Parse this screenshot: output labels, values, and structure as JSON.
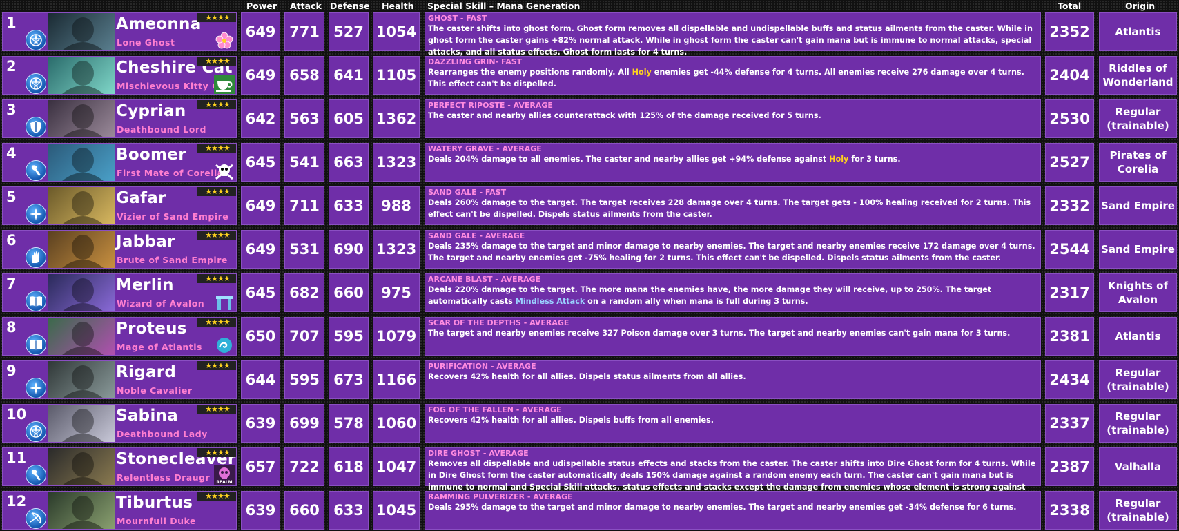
{
  "headers": {
    "power": "Power",
    "attack": "Attack",
    "defense": "Defense",
    "health": "Health",
    "skill": "Special Skill – Mana Generation",
    "total": "Total",
    "origin": "Origin"
  },
  "heroes": [
    {
      "rank": "1",
      "name": "Ameonna",
      "title": "Lone Ghost",
      "stars": "★★★★",
      "class_icon": "paladin-pentagram-icon",
      "family_icon": "sakura-flower-icon",
      "power": "649",
      "attack": "771",
      "defense": "527",
      "health": "1054",
      "skill_name": "GHOST - FAST",
      "desc_a": "The caster shifts into ghost form. Ghost form removes all dispellable and undispellable buffs and status ailments from the caster. While in ghost form the caster gains +82% normal attack. While in ghost form the caster can't gain mana but is immune to normal attacks, special attacks, and all status effects. Ghost form lasts for 4 turns.",
      "hl_b": "",
      "desc_c": "",
      "hl_type": "",
      "total": "2352",
      "origin": "Atlantis"
    },
    {
      "rank": "2",
      "name": "Cheshire Cat",
      "title": "Mischievous Kitty Cat",
      "stars": "★★★★",
      "class_icon": "paladin-pentagram-icon",
      "family_icon": "teacup-icon",
      "power": "649",
      "attack": "658",
      "defense": "641",
      "health": "1105",
      "skill_name": "DAZZLING GRIN- FAST",
      "desc_a": "Rearranges the enemy positions randomly. All ",
      "hl_b": "Holy",
      "desc_c": " enemies get -44% defense for 4 turns. All enemies receive 276 damage over 4 turns. This effect can't be dispelled.",
      "hl_type": "yellow",
      "total": "2404",
      "origin": "Riddles of Wonderland"
    },
    {
      "rank": "3",
      "name": "Cyprian",
      "title": "Deathbound Lord",
      "stars": "★★★★",
      "class_icon": "fighter-shield-icon",
      "family_icon": "",
      "power": "642",
      "attack": "563",
      "defense": "605",
      "health": "1362",
      "skill_name": "PERFECT RIPOSTE - AVERAGE",
      "desc_a": "The caster and nearby allies counterattack with 125% of the damage received for 5 turns.",
      "hl_b": "",
      "desc_c": "",
      "hl_type": "",
      "total": "2530",
      "origin": "Regular (trainable)"
    },
    {
      "rank": "4",
      "name": "Boomer",
      "title": "First Mate of Corelia",
      "stars": "★★★★",
      "class_icon": "barbarian-axe-icon",
      "family_icon": "skull-crossbones-icon",
      "power": "645",
      "attack": "541",
      "defense": "663",
      "health": "1323",
      "skill_name": "WATERY GRAVE - AVERAGE",
      "desc_a": "Deals 204% damage to all enemies. The caster and nearby allies get +94% defense against ",
      "hl_b": "Holy",
      "desc_c": " for 3 turns.",
      "hl_type": "yellow",
      "total": "2527",
      "origin": "Pirates of Corelia"
    },
    {
      "rank": "5",
      "name": "Gafar",
      "title": "Vizier of Sand Empire",
      "stars": "★★★★",
      "class_icon": "cleric-star-icon",
      "family_icon": "",
      "power": "649",
      "attack": "711",
      "defense": "633",
      "health": "988",
      "skill_name": "SAND GALE - FAST",
      "desc_a": "Deals 260% damage to the target. The target receives 228 damage over 4 turns. The target gets - 100% healing received for 2 turns. This effect can't be dispelled. Dispels status ailments from the caster.",
      "hl_b": "",
      "desc_c": "",
      "hl_type": "",
      "total": "2332",
      "origin": "Sand Empire"
    },
    {
      "rank": "6",
      "name": "Jabbar",
      "title": "Brute of Sand Empire",
      "stars": "★★★★",
      "class_icon": "monk-hand-icon",
      "family_icon": "",
      "power": "649",
      "attack": "531",
      "defense": "690",
      "health": "1323",
      "skill_name": "SAND GALE - AVERAGE",
      "desc_a": "Deals 235% damage to the target and minor damage to nearby enemies. The target and nearby enemies receive 172 damage over 4 turns. The target and nearby enemies get -75% healing for 2 turns. This effect can't be dispelled. Dispels status ailments from the caster.",
      "hl_b": "",
      "desc_c": "",
      "hl_type": "",
      "total": "2544",
      "origin": "Sand Empire"
    },
    {
      "rank": "7",
      "name": "Merlin",
      "title": "Wizard of Avalon",
      "stars": "★★★★",
      "class_icon": "wizard-book-icon",
      "family_icon": "stonehenge-icon",
      "power": "645",
      "attack": "682",
      "defense": "660",
      "health": "975",
      "skill_name": "ARCANE BLAST - AVERAGE",
      "desc_a": "Deals 220% damage to the target. The more mana the enemies have, the more damage they will receive, up to 250%. The target automatically casts ",
      "hl_b": "Mindless Attack",
      "desc_c": " on a random ally when mana is full during 3 turns.",
      "hl_type": "blue",
      "total": "2317",
      "origin": "Knights of Avalon"
    },
    {
      "rank": "8",
      "name": "Proteus",
      "title": "Mage of Atlantis",
      "stars": "★★★★",
      "class_icon": "wizard-book-icon",
      "family_icon": "atlantis-wave-icon",
      "power": "650",
      "attack": "707",
      "defense": "595",
      "health": "1079",
      "skill_name": "SCAR OF THE DEPTHS - AVERAGE",
      "desc_a": "The target and nearby enemies receive 327 Poison damage over 3 turns. The target and nearby enemies can't gain mana for 3 turns.",
      "hl_b": "",
      "desc_c": "",
      "hl_type": "",
      "total": "2381",
      "origin": "Atlantis"
    },
    {
      "rank": "9",
      "name": "Rigard",
      "title": "Noble Cavalier",
      "stars": "★★★★",
      "class_icon": "cleric-star-icon",
      "family_icon": "",
      "power": "644",
      "attack": "595",
      "defense": "673",
      "health": "1166",
      "skill_name": "PURIFICATION - AVERAGE",
      "desc_a": "Recovers 42% health for all allies. Dispels status ailments from all allies.",
      "hl_b": "",
      "desc_c": "",
      "hl_type": "",
      "total": "2434",
      "origin": "Regular (trainable)"
    },
    {
      "rank": "10",
      "name": "Sabina",
      "title": "Deathbound Lady",
      "stars": "★★★★",
      "class_icon": "paladin-pentagram-icon",
      "family_icon": "",
      "power": "639",
      "attack": "699",
      "defense": "578",
      "health": "1060",
      "skill_name": "FOG OF THE FALLEN - AVERAGE",
      "desc_a": "Recovers 42% health for all allies. Dispels buffs from all enemies.",
      "hl_b": "",
      "desc_c": "",
      "hl_type": "",
      "total": "2337",
      "origin": "Regular (trainable)"
    },
    {
      "rank": "11",
      "name": "Stonecleaver",
      "title": "Relentless Draugr",
      "stars": "★★★★",
      "class_icon": "barbarian-axe-icon",
      "family_icon": "realm-skull-icon",
      "family_label": "REALM",
      "power": "657",
      "attack": "722",
      "defense": "618",
      "health": "1047",
      "skill_name": "DIRE GHOST - AVERAGE",
      "desc_a": "Removes all dispellable and udispellable status effects and stacks from the caster. The caster shifts into Dire Ghost form for 4 turns. While in Dire Ghost form the caster automatically deals 150% damage against a random enemy each turn. The caster can't gain mana but is immune to normal and Special Skill attacks, status effects and stacks except the damage from enemies whose element is strong against the caster.",
      "hl_b": "",
      "desc_c": "",
      "hl_type": "",
      "total": "2387",
      "origin": "Valhalla"
    },
    {
      "rank": "12",
      "name": "Tiburtus",
      "title": "Mournfull Duke",
      "stars": "★★★★",
      "class_icon": "ranger-bow-icon",
      "family_icon": "",
      "power": "639",
      "attack": "660",
      "defense": "633",
      "health": "1045",
      "skill_name": "RAMMING PULVERIZER - AVERAGE",
      "desc_a": "Deals 295% damage to the target and minor damage to nearby enemies. The target and nearby enemies get -34% defense for 6 turns.",
      "hl_b": "",
      "desc_c": "",
      "hl_type": "",
      "total": "2338",
      "origin": "Regular (trainable)"
    }
  ]
}
